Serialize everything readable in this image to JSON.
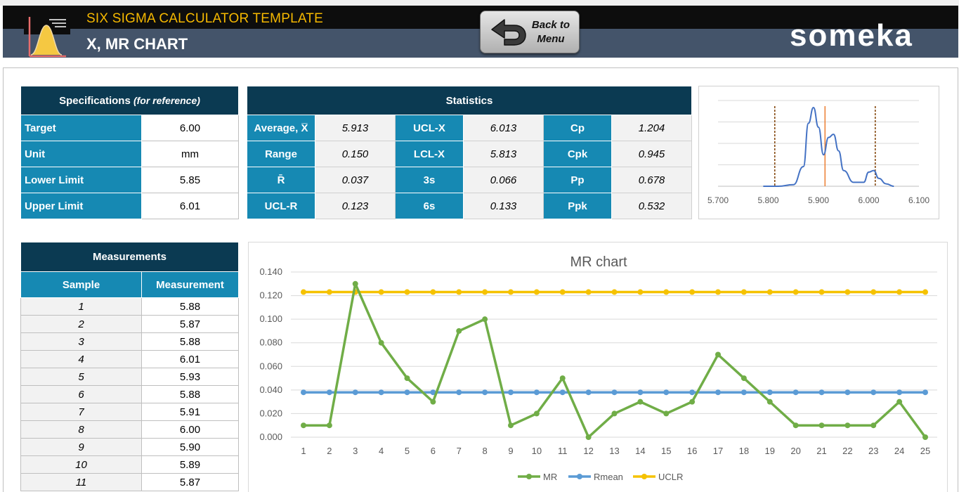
{
  "header": {
    "title": "SIX SIGMA CALCULATOR TEMPLATE",
    "subtitle": "X, MR CHART",
    "back_button": "Back to Menu",
    "back_line1": "Back to",
    "back_line2": "Menu",
    "brand": "someka",
    "colors": {
      "title": "#f5b800",
      "band": "#44546a",
      "accent_dark": "#0b3a52",
      "accent_blue": "#1689b3"
    }
  },
  "specifications": {
    "heading": "Specifications",
    "heading_note": "(for reference)",
    "rows": [
      {
        "label": "Target",
        "value": "6.00"
      },
      {
        "label": "Unit",
        "value": "mm"
      },
      {
        "label": "Lower Limit",
        "value": "5.85"
      },
      {
        "label": "Upper Limit",
        "value": "6.01"
      }
    ]
  },
  "statistics": {
    "heading": "Statistics",
    "rows": [
      [
        {
          "label": "Average, X̅",
          "value": "5.913"
        },
        {
          "label": "UCL-X",
          "value": "6.013"
        },
        {
          "label": "Cp",
          "value": "1.204"
        }
      ],
      [
        {
          "label": "Range",
          "value": "0.150"
        },
        {
          "label": "LCL-X",
          "value": "5.813"
        },
        {
          "label": "Cpk",
          "value": "0.945"
        }
      ],
      [
        {
          "label": "R̄",
          "value": "0.037"
        },
        {
          "label": "3s",
          "value": "0.066"
        },
        {
          "label": "Pp",
          "value": "0.678"
        }
      ],
      [
        {
          "label": "UCL-R",
          "value": "0.123"
        },
        {
          "label": "6s",
          "value": "0.133"
        },
        {
          "label": "Ppk",
          "value": "0.532"
        }
      ]
    ]
  },
  "measurements": {
    "heading": "Measurements",
    "col_sample": "Sample",
    "col_measurement": "Measurement",
    "rows": [
      {
        "sample": "1",
        "value": "5.88"
      },
      {
        "sample": "2",
        "value": "5.87"
      },
      {
        "sample": "3",
        "value": "5.88"
      },
      {
        "sample": "4",
        "value": "6.01"
      },
      {
        "sample": "5",
        "value": "5.93"
      },
      {
        "sample": "6",
        "value": "5.88"
      },
      {
        "sample": "7",
        "value": "5.91"
      },
      {
        "sample": "8",
        "value": "6.00"
      },
      {
        "sample": "9",
        "value": "5.90"
      },
      {
        "sample": "10",
        "value": "5.89"
      },
      {
        "sample": "11",
        "value": "5.87"
      }
    ]
  },
  "chart_data": [
    {
      "type": "line",
      "title": "",
      "x_ticks": [
        "5.700",
        "5.800",
        "5.900",
        "6.000",
        "6.100"
      ],
      "xlim": [
        5.7,
        6.1
      ],
      "density_x": [
        5.79,
        5.82,
        5.85,
        5.87,
        5.88,
        5.89,
        5.9,
        5.91,
        5.92,
        5.93,
        5.94,
        5.95,
        5.97,
        5.99,
        6.0,
        6.01,
        6.02,
        6.035,
        6.05
      ],
      "density_y": [
        0.0,
        0.0,
        0.02,
        0.25,
        0.8,
        1.0,
        0.75,
        0.4,
        0.62,
        0.66,
        0.45,
        0.2,
        0.05,
        0.05,
        0.18,
        0.2,
        0.1,
        0.03,
        0.0
      ],
      "vlines": [
        {
          "x": 5.813,
          "color": "#7f3f00",
          "dashed": true
        },
        {
          "x": 5.913,
          "color": "#ed7d31",
          "dashed": false
        },
        {
          "x": 6.013,
          "color": "#7f3f00",
          "dashed": true
        }
      ],
      "grid": true
    },
    {
      "type": "line",
      "title": "MR chart",
      "x": [
        1,
        2,
        3,
        4,
        5,
        6,
        7,
        8,
        9,
        10,
        11,
        12,
        13,
        14,
        15,
        16,
        17,
        18,
        19,
        20,
        21,
        22,
        23,
        24,
        25
      ],
      "ylim": [
        0,
        0.14
      ],
      "y_ticks": [
        "0.000",
        "0.020",
        "0.040",
        "0.060",
        "0.080",
        "0.100",
        "0.120",
        "0.140"
      ],
      "grid": true,
      "legend_position": "bottom",
      "series": [
        {
          "name": "MR",
          "color": "#70ad47",
          "values": [
            0.01,
            0.01,
            0.13,
            0.08,
            0.05,
            0.03,
            0.09,
            0.1,
            0.01,
            0.02,
            0.05,
            0.0,
            0.02,
            0.03,
            0.02,
            0.03,
            0.07,
            0.05,
            0.03,
            0.01,
            0.01,
            0.01,
            0.01,
            0.03,
            0.0
          ]
        },
        {
          "name": "Rmean",
          "color": "#5b9bd5",
          "values": [
            0.038,
            0.038,
            0.038,
            0.038,
            0.038,
            0.038,
            0.038,
            0.038,
            0.038,
            0.038,
            0.038,
            0.038,
            0.038,
            0.038,
            0.038,
            0.038,
            0.038,
            0.038,
            0.038,
            0.038,
            0.038,
            0.038,
            0.038,
            0.038,
            0.038
          ]
        },
        {
          "name": "UCLR",
          "color": "#f5c200",
          "values": [
            0.123,
            0.123,
            0.123,
            0.123,
            0.123,
            0.123,
            0.123,
            0.123,
            0.123,
            0.123,
            0.123,
            0.123,
            0.123,
            0.123,
            0.123,
            0.123,
            0.123,
            0.123,
            0.123,
            0.123,
            0.123,
            0.123,
            0.123,
            0.123,
            0.123
          ]
        }
      ]
    }
  ]
}
